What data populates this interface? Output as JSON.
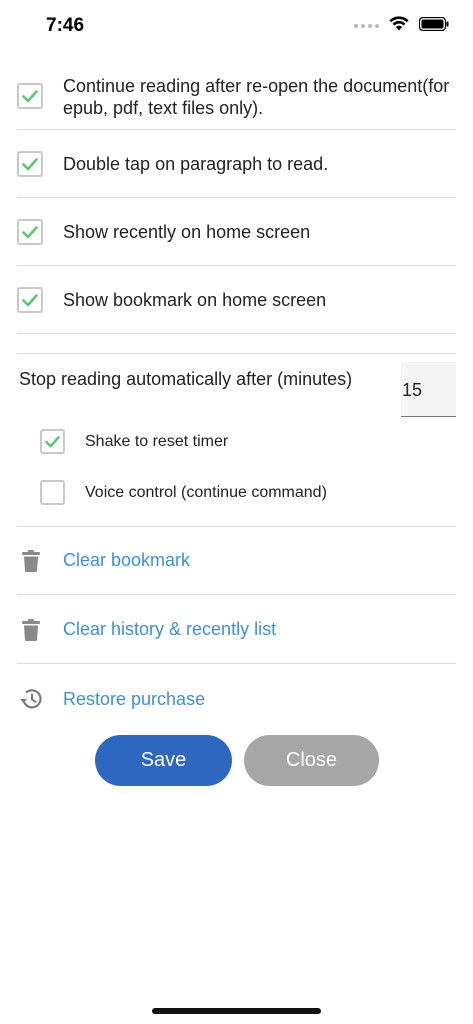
{
  "status_bar": {
    "time": "7:46"
  },
  "settings": [
    {
      "label": "Continue reading after re-open the document(for epub, pdf, text files only).",
      "checked": true
    },
    {
      "label": "Double tap on paragraph to read.",
      "checked": true
    },
    {
      "label": "Show recently on home screen",
      "checked": true
    },
    {
      "label": "Show bookmark on home screen",
      "checked": true
    }
  ],
  "timer": {
    "label": "Stop reading automatically after (minutes)",
    "value": "15",
    "options": [
      {
        "label": "Shake to reset timer",
        "checked": true
      },
      {
        "label": "Voice control (continue command)",
        "checked": false
      }
    ]
  },
  "actions": [
    {
      "label": "Clear bookmark",
      "icon": "trash-icon"
    },
    {
      "label": "Clear history & recently list",
      "icon": "trash-icon"
    },
    {
      "label": "Restore purchase",
      "icon": "restore-history-icon"
    }
  ],
  "buttons": {
    "save": "Save",
    "close": "Close"
  },
  "colors": {
    "accent": "#2f66c0",
    "link": "#3d8fd9",
    "check": "#5cc76e",
    "disabled": "#a6a6a6"
  }
}
